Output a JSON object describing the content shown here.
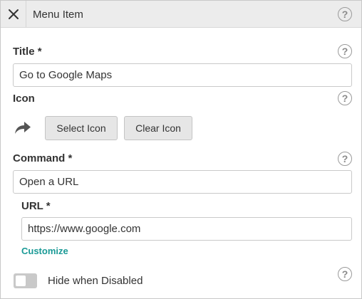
{
  "header": {
    "title": "Menu Item",
    "close_icon": "close-icon",
    "help_icon": "help-icon"
  },
  "title_field": {
    "label": "Title *",
    "value": "Go to Google Maps"
  },
  "icon_section": {
    "label": "Icon",
    "current_icon": "share-arrow-icon",
    "select_label": "Select Icon",
    "clear_label": "Clear Icon"
  },
  "command_field": {
    "label": "Command *",
    "value": "Open a URL"
  },
  "url_field": {
    "label": "URL *",
    "value": "https://www.google.com",
    "customize_label": "Customize"
  },
  "hide_toggle": {
    "label": "Hide when Disabled",
    "enabled": false
  },
  "help_glyph": "?",
  "colors": {
    "accent": "#1a9a96",
    "header_bg": "#ececec",
    "button_bg": "#e6e6e6"
  }
}
